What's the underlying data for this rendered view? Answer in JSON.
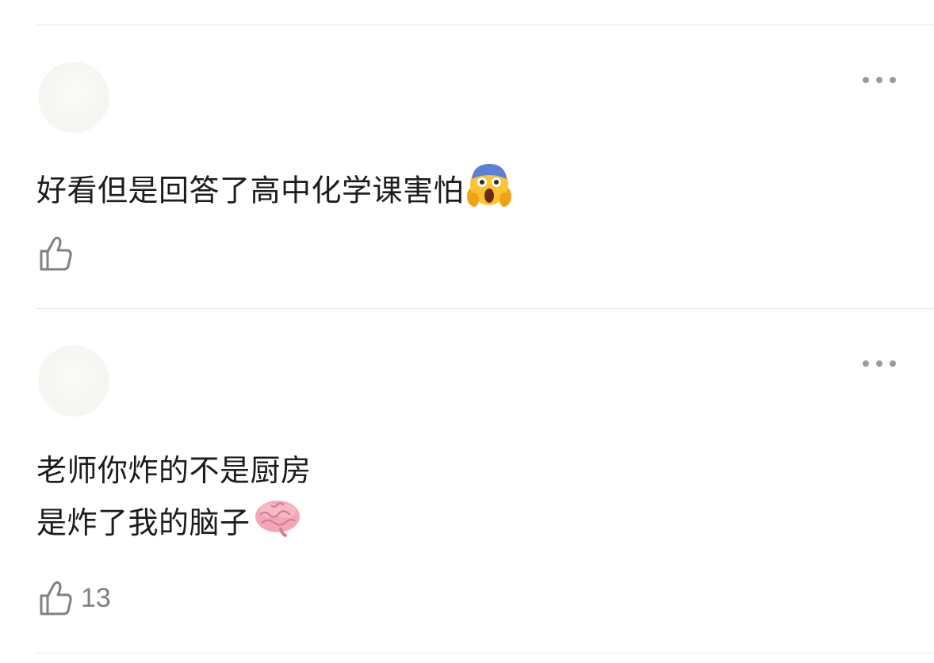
{
  "comments": [
    {
      "text_lines": [
        "好看但是回答了高中化学课害怕"
      ],
      "emoji": "face-screaming-in-fear-emoji",
      "like_count": ""
    },
    {
      "text_lines": [
        "老师你炸的不是厨房",
        "是炸了我的脑子"
      ],
      "emoji": "brain-emoji",
      "like_count": "13"
    }
  ],
  "icons": {
    "more": "more-dots-icon",
    "like": "thumbs-up-icon"
  },
  "colors": {
    "icon_gray": "#808080",
    "divider": "#e6e6e6",
    "text": "#1c1c1c"
  }
}
